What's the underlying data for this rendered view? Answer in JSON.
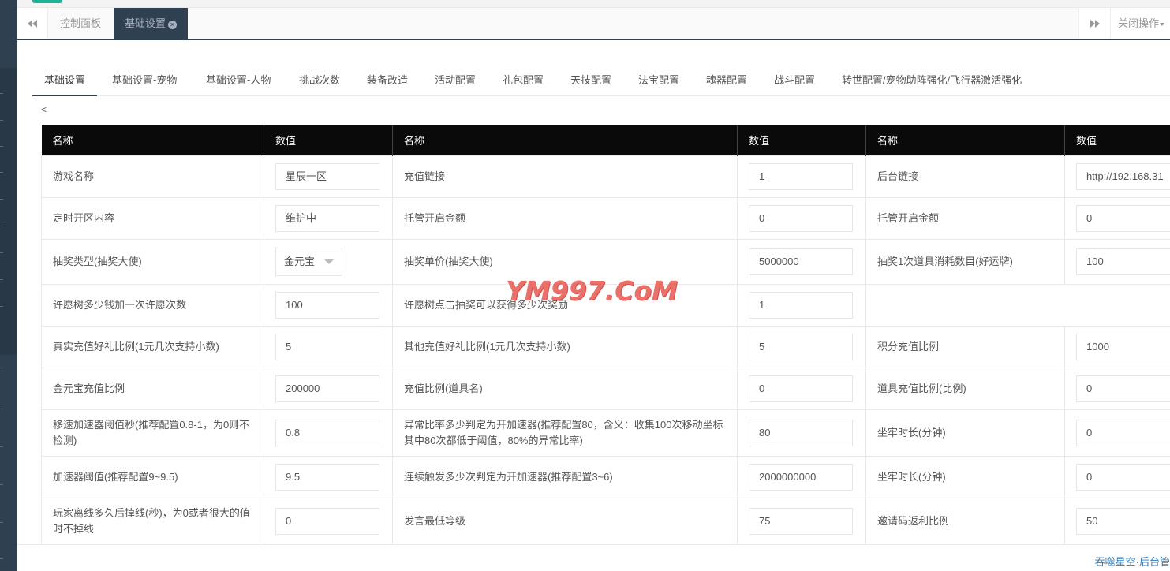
{
  "page_tabs": {
    "prev_icon": "backward-icon",
    "next_icon": "forward-icon",
    "dashboard": "控制面板",
    "active": "基础设置",
    "close_ops": "关闭操作"
  },
  "content_tabs": [
    "基础设置",
    "基础设置-宠物",
    "基础设置-人物",
    "挑战次数",
    "装备改造",
    "活动配置",
    "礼包配置",
    "天技配置",
    "法宝配置",
    "魂器配置",
    "战斗配置",
    "转世配置/宠物助阵强化/飞行器激活强化"
  ],
  "back_marker": "<",
  "table": {
    "headers": [
      "名称",
      "数值",
      "名称",
      "数值",
      "名称",
      "数值"
    ],
    "rows": [
      {
        "n1": "游戏名称",
        "v1": "星辰一区",
        "n2": "充值链接",
        "v2": "1",
        "n3": "后台链接",
        "v3": "http://192.168.31"
      },
      {
        "n1": "定时开区内容",
        "v1": "维护中",
        "n2": "托管开启金额",
        "v2": "0",
        "n3": "托管开启金额",
        "v3": "0"
      },
      {
        "n1": "抽奖类型(抽奖大使)",
        "v1": "金元宝",
        "n2": "抽奖单价(抽奖大使)",
        "v2": "5000000",
        "n3": "抽奖1次道具消耗数目(好运牌)",
        "v3": "100"
      },
      {
        "n1": "许愿树多少钱加一次许愿次数",
        "v1": "100",
        "n2": "许愿树点击抽奖可以获得多少次奖励",
        "v2": "1",
        "n3": "",
        "v3": ""
      },
      {
        "n1": "真实充值好礼比例(1元几次支持小数)",
        "v1": "5",
        "n2": "其他充值好礼比例(1元几次支持小数)",
        "v2": "5",
        "n3": "积分充值比例",
        "v3": "1000"
      },
      {
        "n1": "金元宝充值比例",
        "v1": "200000",
        "n2": "充值比例(道具名)",
        "v2": "0",
        "n3": "道具充值比例(比例)",
        "v3": "0"
      },
      {
        "n1": "移速加速器阈值秒(推荐配置0.8-1，为0则不检测)",
        "v1": "0.8",
        "n2": "异常比率多少判定为开加速器(推荐配置80，含义：收集100次移动坐标其中80次都低于阈值，80%的异常比率)",
        "v2": "80",
        "n3": "坐牢时长(分钟)",
        "v3": "0"
      },
      {
        "n1": "加速器阈值(推荐配置9~9.5)",
        "v1": "9.5",
        "n2": "连续触发多少次判定为开加速器(推荐配置3~6)",
        "v2": "2000000000",
        "n3": "坐牢时长(分钟)",
        "v3": "0"
      },
      {
        "n1": "玩家离线多久后掉线(秒)，为0或者很大的值时不掉线",
        "v1": "0",
        "n2": "发言最低等级",
        "v2": "75",
        "n3": "邀请码返利比例",
        "v3": "50"
      }
    ]
  },
  "watermark": "YM997.CoM",
  "footer": "吞噬星空·后台管"
}
